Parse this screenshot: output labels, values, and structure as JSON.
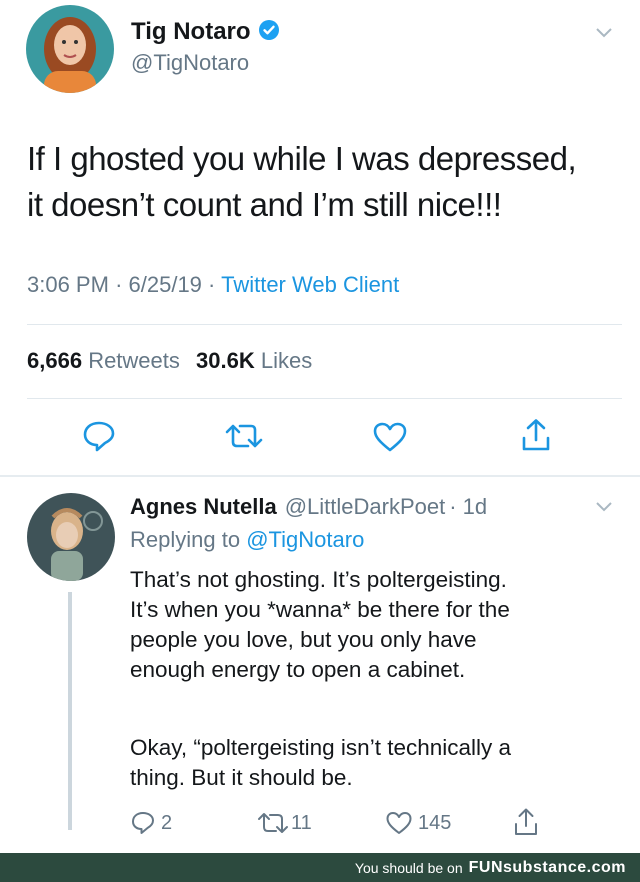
{
  "tweet": {
    "author_name": "Tig Notaro",
    "author_handle": "@TigNotaro",
    "text": "If I ghosted you while I was depressed,\nit doesn’t count and I’m still nice!!!",
    "time": "3:06 PM",
    "date": "6/25/19",
    "separator": "·",
    "client": "Twitter Web Client",
    "retweets_count": "6,666",
    "retweets_label": "Retweets",
    "likes_count": "30.6K",
    "likes_label": "Likes"
  },
  "reply": {
    "author_name": "Agnes Nutella",
    "author_handle": "@LittleDarkPoet",
    "age": "· 1d",
    "replying_prefix": "Replying to",
    "replying_handle": "@TigNotaro",
    "paragraph1": "That’s not ghosting. It’s poltergeisting.\nIt’s when you *wanna* be there for the\npeople you love, but you only have\nenough energy to open a cabinet.",
    "paragraph2": "Okay, “poltergeisting isn’t technically a\nthing. But it should be.",
    "reply_count": "2",
    "retweet_count": "11",
    "like_count": "145"
  },
  "footer": {
    "text": "You should be on",
    "brand": "FUNsubstance.com"
  },
  "colors": {
    "link_blue": "#1b95e0",
    "muted_gray": "#657786",
    "footer_bg": "#2c4a3e"
  },
  "icons": [
    "verified-badge-icon",
    "chevron-down-icon",
    "reply-icon",
    "retweet-icon",
    "heart-icon",
    "share-icon"
  ]
}
